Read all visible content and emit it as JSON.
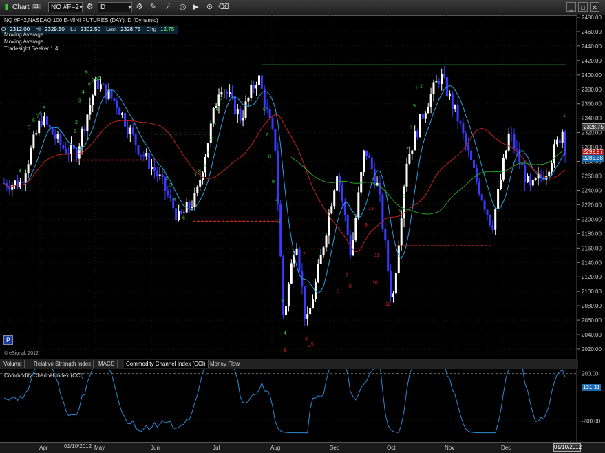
{
  "toolbar": {
    "title": "Chart",
    "badge": "S1",
    "symbol": "NQ #F=2",
    "interval": "D"
  },
  "header": {
    "line1": "NQ #F=2,NASDAQ 100 E-MINI FUTURES (DAY), D (Dynamic)",
    "study1": "Moving Average",
    "study2": "Moving Average",
    "study3": "Tradesight Seeker 1.4"
  },
  "quote": {
    "open_label": "O",
    "open": "2312.00",
    "high_label": "Hi",
    "high": "2329.50",
    "low_label": "Lo",
    "low": "2302.50",
    "last_label": "Last",
    "last": "2328.75",
    "chg_label": "Chg",
    "chg": "12.75"
  },
  "price_axis": [
    "2480.00",
    "2460.00",
    "2440.00",
    "2420.00",
    "2400.00",
    "2380.00",
    "2360.00",
    "2340.00",
    "2320.00",
    "2300.00",
    "2280.00",
    "2260.00",
    "2240.00",
    "2220.00",
    "2200.00",
    "2180.00",
    "2160.00",
    "2140.00",
    "2120.00",
    "2100.00",
    "2080.00",
    "2060.00",
    "2040.00",
    "2020.00"
  ],
  "price_badges": {
    "last": "2328.75",
    "ma_red": "2292.97",
    "ma_blue": "2285.38"
  },
  "tabs": [
    "Volume",
    "Relative Strength Index",
    "MACD",
    "Commodity Channel Index (CCI)",
    "Money Flow"
  ],
  "indicator": {
    "title": "Commodity Channel Index (CCI)",
    "axis": [
      "200.00",
      "-200.00"
    ],
    "current": "131.31"
  },
  "months": [
    "Apr",
    "May",
    "Jun",
    "Jul",
    "Aug",
    "Sep",
    "Oct",
    "Nov",
    "Dec"
  ],
  "footer": {
    "left_date": "01/10/2012",
    "right_date": "01/10/2012",
    "copyright": "© eSignal, 2012",
    "p_button": "P"
  },
  "colors": {
    "up": "#ffffff",
    "down": "#3a3aff",
    "ma_red": "#c81e1e",
    "ma_blue": "#2aa0e0",
    "ma_green": "#28a028",
    "resistance": "#1fa01f",
    "support": "#d02020",
    "cci": "#2a8ad8"
  },
  "seeker": {
    "green_counts": [
      "6",
      "7",
      "8",
      "9",
      "5",
      "4",
      "3",
      "2",
      "1",
      "4",
      "5",
      "6",
      "7",
      "8",
      "9",
      "1",
      "2",
      "3",
      "4",
      "5",
      "6",
      "7",
      "8",
      "9",
      "1",
      "2",
      "3",
      "4",
      "5",
      "6",
      "7",
      "8",
      "9",
      "1",
      "2",
      "3",
      "4",
      "5",
      "6",
      "7",
      "8",
      "9",
      "1",
      "2",
      "1",
      "3",
      "4",
      "5",
      "6",
      "7",
      "8",
      "9",
      "1"
    ],
    "red_counts": [
      "1",
      "2",
      "3",
      "4",
      "5",
      "6",
      "7",
      "8",
      "9",
      "10",
      "11",
      "12",
      "13",
      "1"
    ]
  }
}
